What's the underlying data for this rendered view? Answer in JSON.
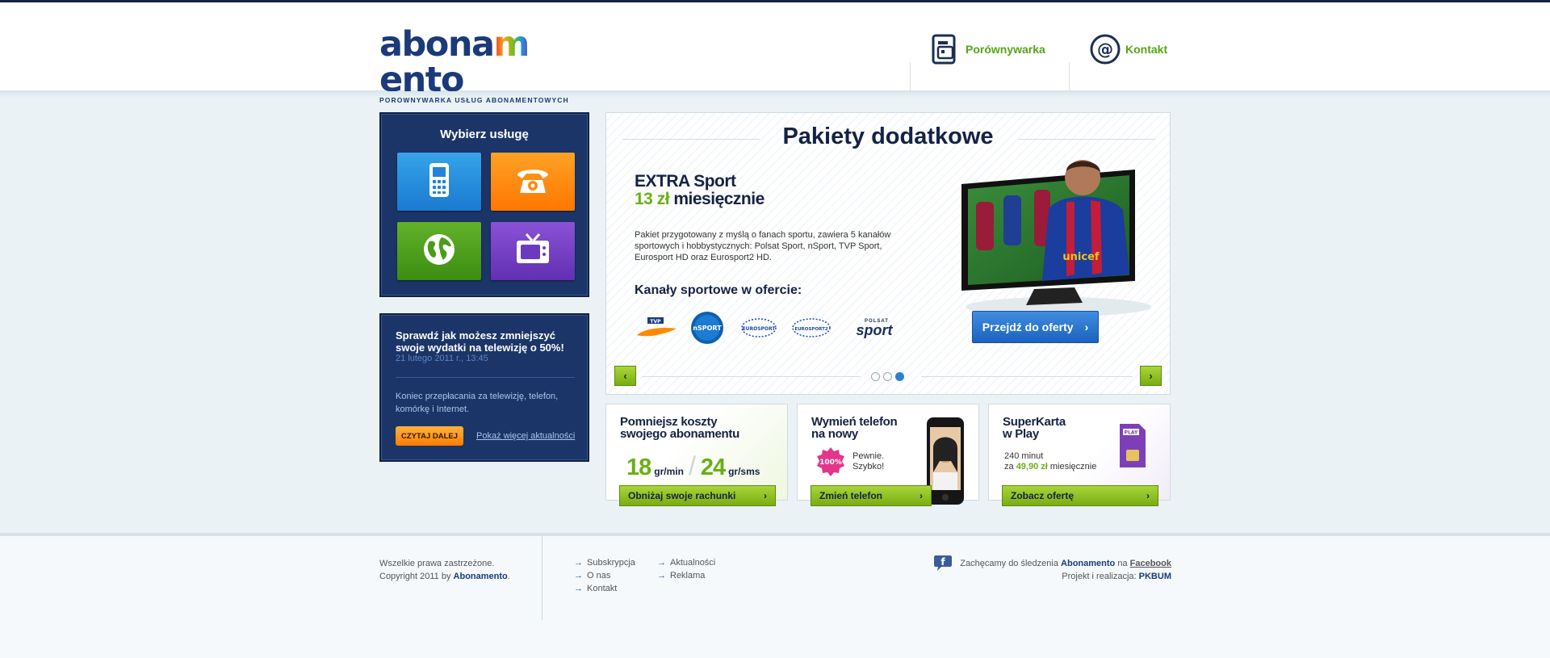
{
  "header": {
    "logo": {
      "text_start": "abona",
      "text_m": "m",
      "text_end": "ento",
      "tagline": "PORÓWNYWARKA USŁUG ABONAMENTOWYCH"
    },
    "nav": [
      {
        "label": "Porównywarka",
        "icon": "compare-icon"
      },
      {
        "label": "Kontakt",
        "icon": "at-icon"
      }
    ]
  },
  "services": {
    "title": "Wybierz usługę",
    "tiles": [
      {
        "icon": "mobile-phone-icon",
        "color": "#1a7ad0"
      },
      {
        "icon": "telephone-icon",
        "color": "#ff7700"
      },
      {
        "icon": "globe-icon",
        "color": "#3c8d13"
      },
      {
        "icon": "tv-icon",
        "color": "#6230b2"
      }
    ]
  },
  "news": {
    "title": "Sprawdź jak możesz zmniejszyć swoje wydatki na telewizję o 50%!",
    "date": "21 lutego 2011 r., 13:45",
    "text": "Koniec przepłacania za telewizję, telefon, komórkę i Internet.",
    "read_more": "CZYTAJ DALEJ",
    "more_news": "Pokaż więcej aktualności"
  },
  "slider": {
    "title": "Pakiety dodatkowe",
    "headline": "EXTRA Sport",
    "price": "13 zł",
    "period": "miesięcznie",
    "description": "Pakiet przygotowany z myślą o fanach sportu, zawiera 5 kanałów sportowych i hobbystycznych: Polsat Sport, nSport, TVP Sport, Eurosport HD oraz Eurosport2 HD.",
    "channels_title": "Kanały sportowe w ofercie:",
    "channels": [
      {
        "name": "TVP SPORT",
        "short": "TVP"
      },
      {
        "name": "nSPORT",
        "short": "nSPORT"
      },
      {
        "name": "EUROSPORT HD",
        "short": "EUROSPORT"
      },
      {
        "name": "EUROSPORT 2 HD",
        "short": "EUROSPORT2"
      },
      {
        "name": "POLSAT SPORT",
        "top": "POLSAT",
        "bottom": "sport"
      }
    ],
    "jersey_text": "unicef",
    "cta": "Przejdź do oferty",
    "active_dot": 3,
    "dots": 3
  },
  "promos": [
    {
      "title_line1": "Pomniejsz koszty",
      "title_line2": "swojego abonamentu",
      "rate1": "18",
      "unit1": "gr/min",
      "rate2": "24",
      "unit2": "gr/sms",
      "button": "Obniżaj swoje rachunki"
    },
    {
      "title_line1": "Wymień telefon",
      "title_line2": "na nowy",
      "badge": "100%",
      "note_line1": "Pewnie.",
      "note_line2": "Szybko!",
      "button": "Zmień telefon"
    },
    {
      "title_line1": "SuperKarta",
      "title_line2": "w Play",
      "minutes": "240 minut",
      "price_prefix": "za",
      "price": "49,90 zł",
      "price_suffix": "miesięcznie",
      "sim_label": "PLAY",
      "button": "Zobacz ofertę"
    }
  ],
  "footer": {
    "rights": "Wszelkie prawa zastrzeżone.",
    "copyright_prefix": "Copyright 2011 by",
    "copyright_brand": "Abonamento",
    "links_col1": [
      "Subskrypcja",
      "O nas",
      "Kontakt"
    ],
    "links_col2": [
      "Aktualności",
      "Reklama"
    ],
    "facebook_prefix": "Zachęcamy do śledzenia",
    "facebook_brand": "Abonamento",
    "facebook_mid": "na",
    "facebook_link": "Facebook",
    "credits_prefix": "Projekt i realizacja:",
    "credits_brand": "PKBUM"
  }
}
